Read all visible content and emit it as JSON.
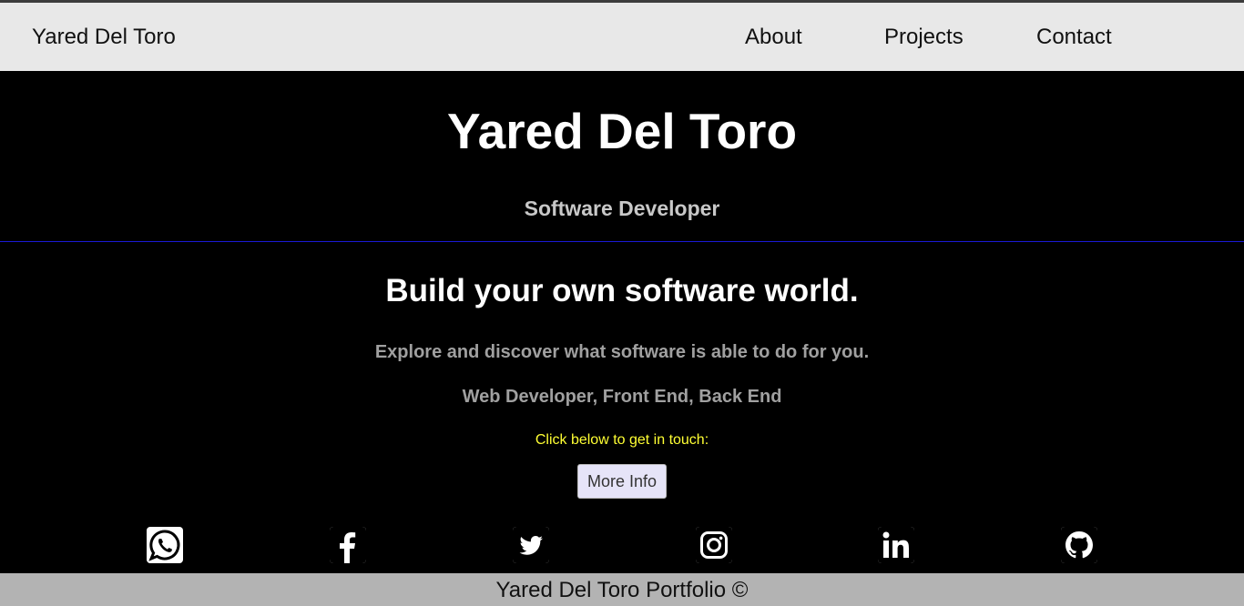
{
  "navbar": {
    "brand": "Yared Del Toro",
    "links": [
      {
        "label": "About"
      },
      {
        "label": "Projects"
      },
      {
        "label": "Contact"
      }
    ]
  },
  "hero": {
    "title": "Yared Del Toro",
    "subtitle": "Software Developer"
  },
  "intro": {
    "headline": "Build your own software world.",
    "tagline": "Explore and discover what software is able to do for you.",
    "skills": "Web Developer, Front End, Back End",
    "cta_text": "Click below to get in touch:",
    "button_label": "More Info"
  },
  "social": [
    {
      "icon": "whatsapp-icon"
    },
    {
      "icon": "facebook-icon"
    },
    {
      "icon": "twitter-icon"
    },
    {
      "icon": "instagram-icon"
    },
    {
      "icon": "linkedin-icon"
    },
    {
      "icon": "github-icon"
    }
  ],
  "footer": {
    "text": "Yared Del Toro Portfolio ©"
  },
  "colors": {
    "navbar_bg": "#e8e8e8",
    "page_bg": "#000000",
    "divider": "#1a1ad6",
    "cta": "#ffff33",
    "button_bg": "#e6e4f8",
    "footer_bg": "#b3b3b3"
  }
}
